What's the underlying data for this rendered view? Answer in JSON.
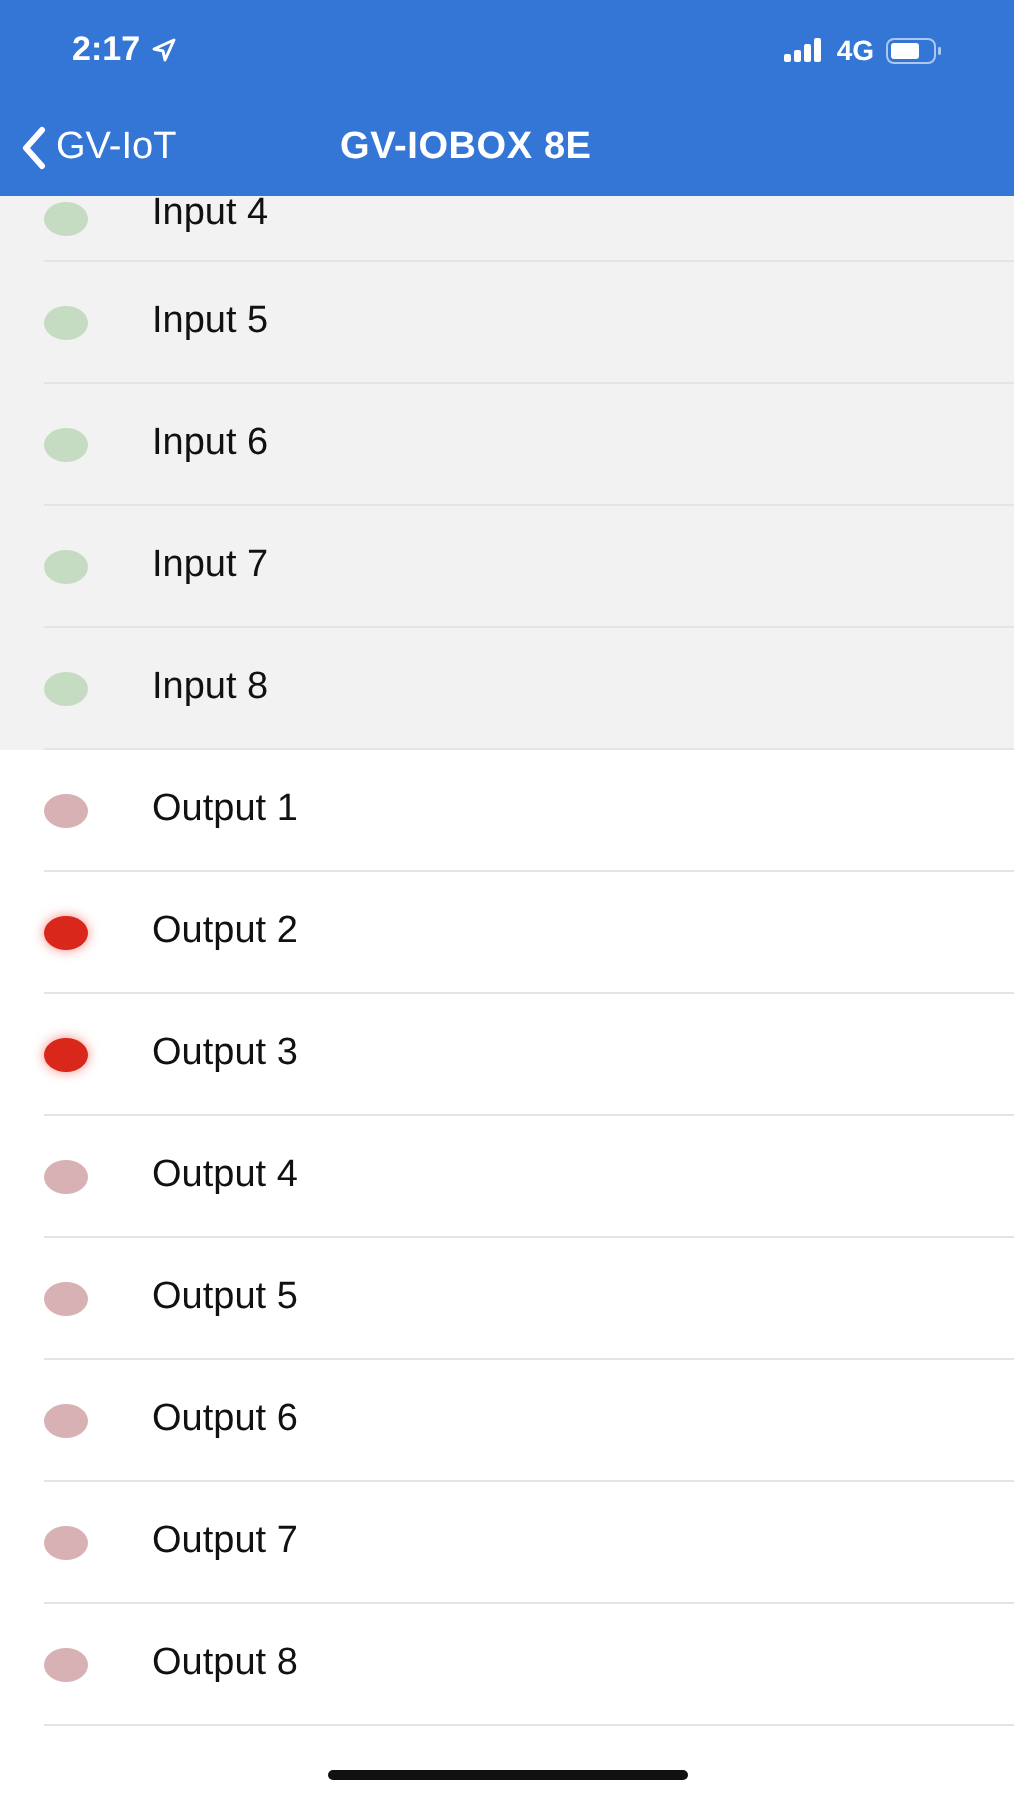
{
  "status_bar": {
    "time": "2:17",
    "network": "4G"
  },
  "nav": {
    "back": "GV-IoT",
    "title": "GV-IOBOX 8E"
  },
  "inputs": [
    {
      "label": "Input 4",
      "on": false
    },
    {
      "label": "Input 5",
      "on": false
    },
    {
      "label": "Input 6",
      "on": false
    },
    {
      "label": "Input 7",
      "on": false
    },
    {
      "label": "Input 8",
      "on": false
    }
  ],
  "outputs": [
    {
      "label": "Output 1",
      "on": false
    },
    {
      "label": "Output 2",
      "on": true
    },
    {
      "label": "Output 3",
      "on": true
    },
    {
      "label": "Output 4",
      "on": false
    },
    {
      "label": "Output 5",
      "on": false
    },
    {
      "label": "Output 6",
      "on": false
    },
    {
      "label": "Output 7",
      "on": false
    },
    {
      "label": "Output 8",
      "on": false
    }
  ]
}
